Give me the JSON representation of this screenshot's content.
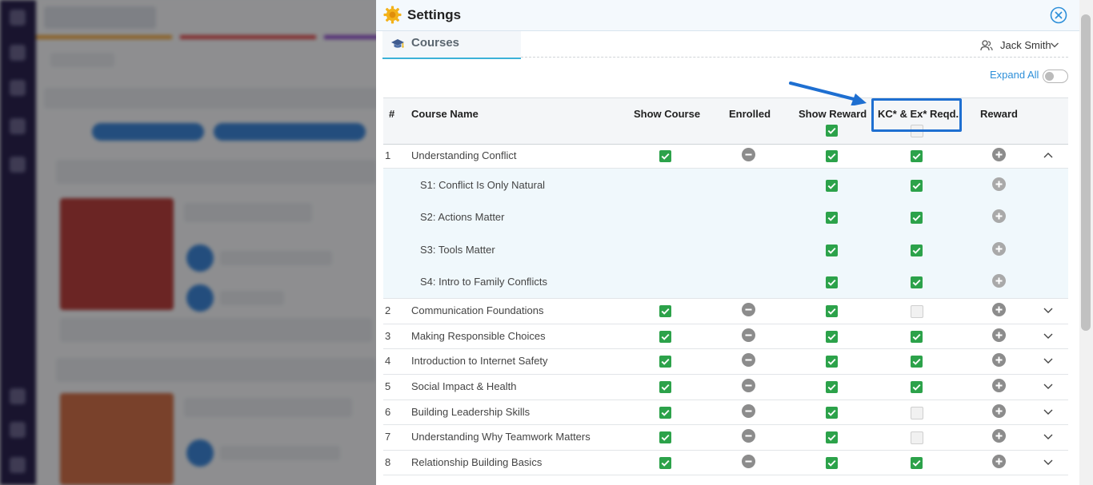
{
  "modal": {
    "title": "Settings",
    "tab_label": "Courses",
    "user_name": "Jack Smith",
    "expand_all_label": "Expand All",
    "expand_all_on": false
  },
  "table": {
    "headers": {
      "num": "#",
      "name": "Course Name",
      "show_course": "Show Course",
      "enrolled": "Enrolled",
      "show_reward": "Show Reward",
      "kc": "KC* & Ex* Reqd.",
      "reward": "Reward"
    },
    "header_checks": {
      "show_reward": true,
      "kc": false
    },
    "rows": [
      {
        "num": "1",
        "name": "Understanding Conflict",
        "kind": "course",
        "expanded": true,
        "show_course": true,
        "show_reward": true,
        "kc": true
      },
      {
        "num": "",
        "name": "S1: Conflict Is Only Natural",
        "kind": "sub",
        "show_reward": true,
        "kc": true
      },
      {
        "num": "",
        "name": "S2: Actions Matter",
        "kind": "sub",
        "show_reward": true,
        "kc": true
      },
      {
        "num": "",
        "name": "S3: Tools Matter",
        "kind": "sub",
        "show_reward": true,
        "kc": true
      },
      {
        "num": "",
        "name": "S4: Intro to Family Conflicts",
        "kind": "sub",
        "show_reward": true,
        "kc": true
      },
      {
        "num": "2",
        "name": "Communication Foundations",
        "kind": "course",
        "expanded": false,
        "show_course": true,
        "show_reward": true,
        "kc": false
      },
      {
        "num": "3",
        "name": "Making Responsible Choices",
        "kind": "course",
        "expanded": false,
        "show_course": true,
        "show_reward": true,
        "kc": true
      },
      {
        "num": "4",
        "name": "Introduction to Internet Safety",
        "kind": "course",
        "expanded": false,
        "show_course": true,
        "show_reward": true,
        "kc": true
      },
      {
        "num": "5",
        "name": "Social Impact & Health",
        "kind": "course",
        "expanded": false,
        "show_course": true,
        "show_reward": true,
        "kc": true
      },
      {
        "num": "6",
        "name": "Building Leadership Skills",
        "kind": "course",
        "expanded": false,
        "show_course": true,
        "show_reward": true,
        "kc": false
      },
      {
        "num": "7",
        "name": "Understanding Why Teamwork Matters",
        "kind": "course",
        "expanded": false,
        "show_course": true,
        "show_reward": true,
        "kc": false
      },
      {
        "num": "8",
        "name": "Relationship Building Basics",
        "kind": "course",
        "expanded": false,
        "show_course": true,
        "show_reward": true,
        "kc": true
      }
    ]
  },
  "colors": {
    "accent": "#2d8fd9",
    "check_green": "#2ca24a",
    "highlight_blue": "#1e6fd1",
    "tab_underline": "#3db2d8"
  },
  "icons": {
    "settings": "gear-icon",
    "tab": "graduation-cap-icon",
    "user": "user-icon",
    "close": "close-icon",
    "enrolled": "minus-circle-icon",
    "reward": "plus-circle-icon"
  }
}
